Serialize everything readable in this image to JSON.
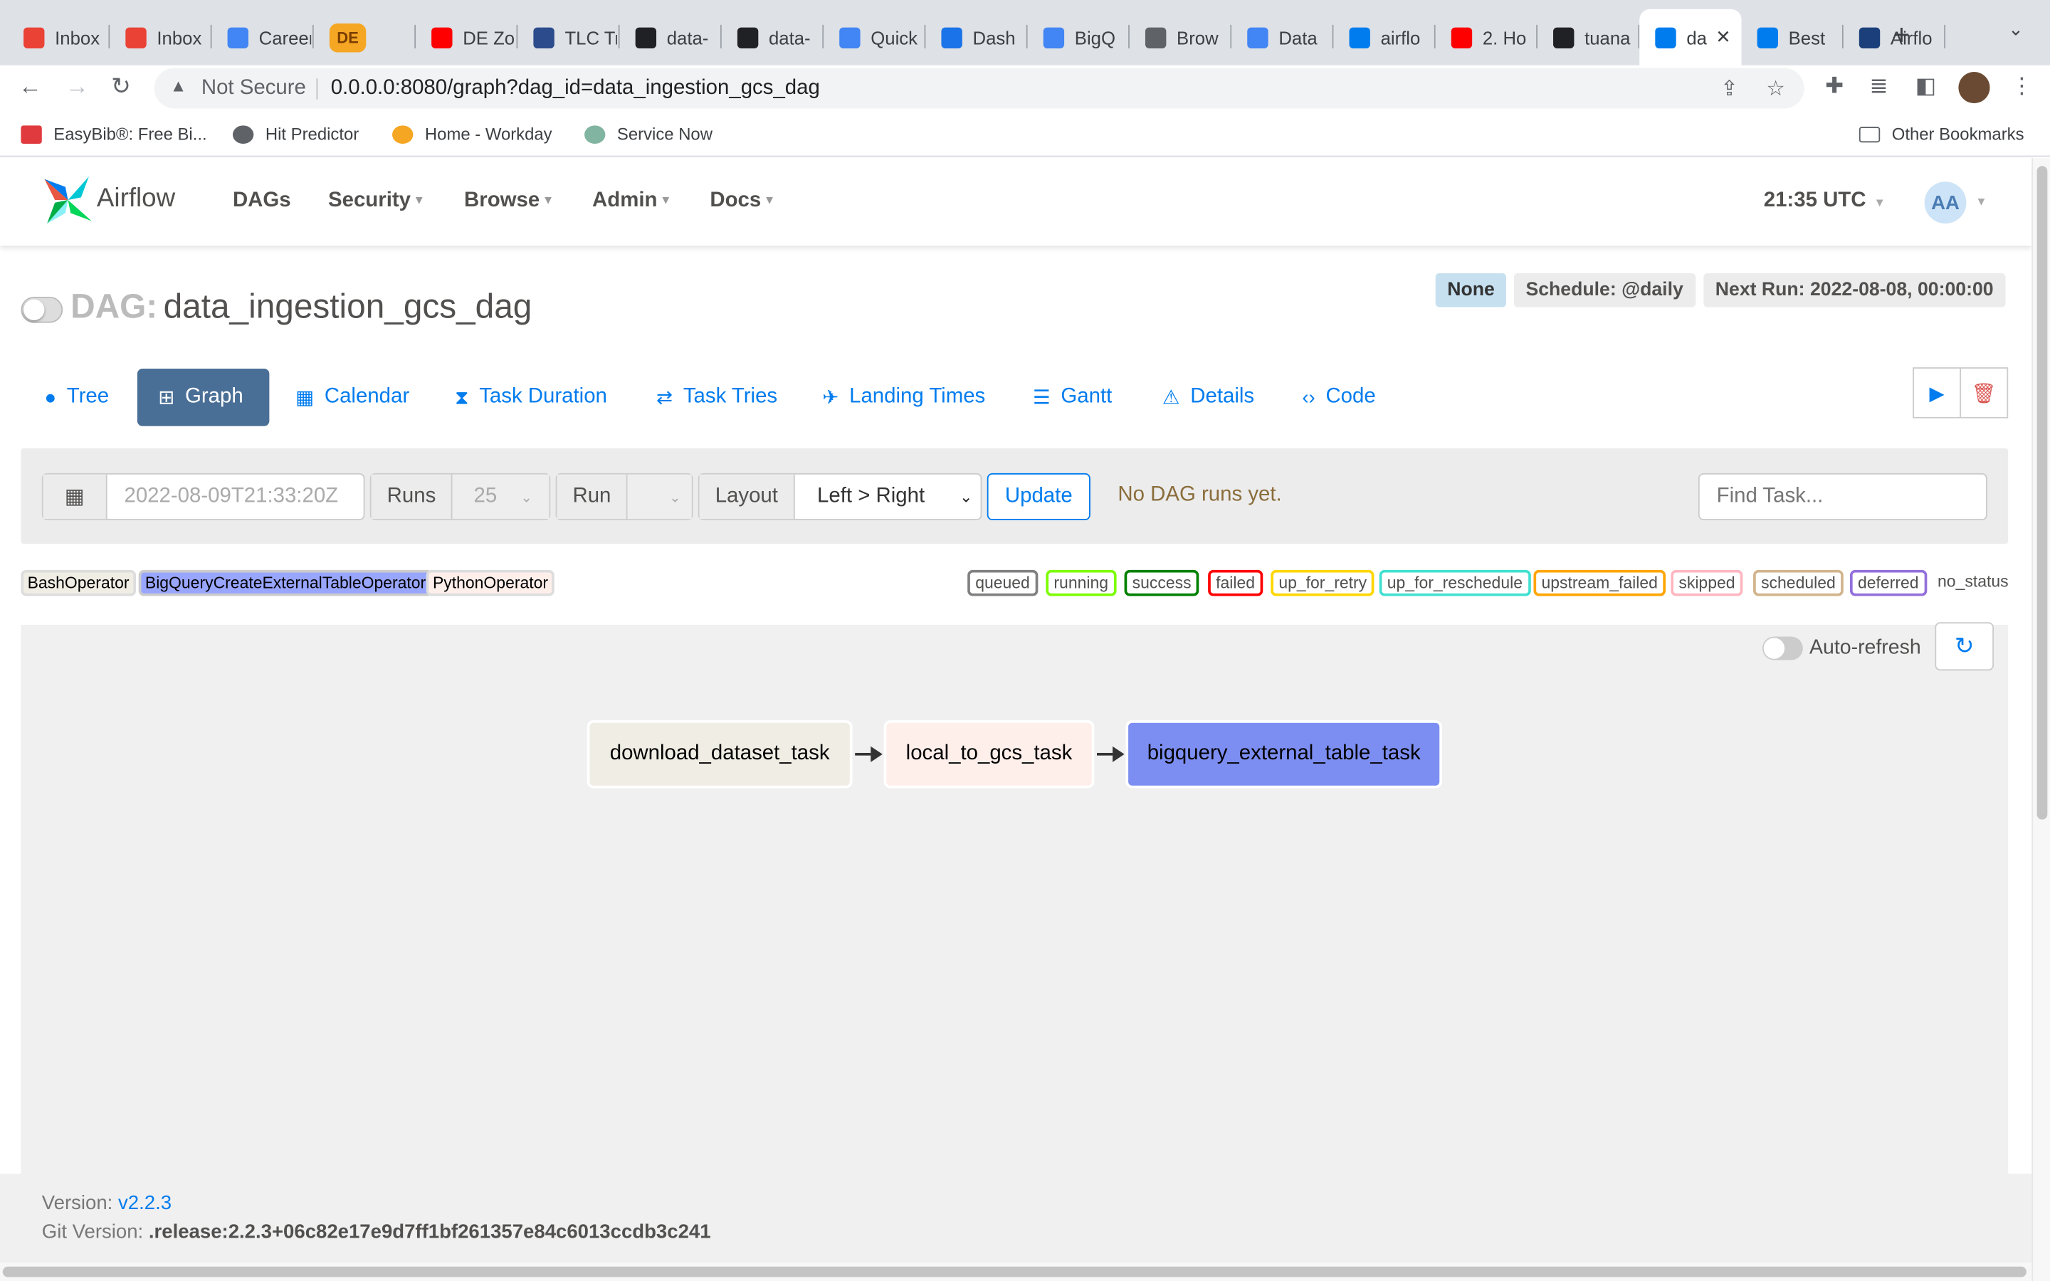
{
  "browser": {
    "tabs": [
      {
        "title": "Inbox",
        "icon": "gmail-icon",
        "color": "#ea4335"
      },
      {
        "title": "Inbox",
        "icon": "gmail-icon",
        "color": "#ea4335"
      },
      {
        "title": "Careers",
        "icon": "docs-icon",
        "color": "#4285f4"
      },
      {
        "title": "",
        "icon": "de-icon",
        "color": "#f5a623",
        "label": "DE"
      },
      {
        "title": "DE Zoomcamp",
        "icon": "youtube-icon",
        "color": "#ff0000"
      },
      {
        "title": "TLC Trip",
        "icon": "tlc-icon",
        "color": "#2b4b8c"
      },
      {
        "title": "data-",
        "icon": "github-icon",
        "color": "#202124"
      },
      {
        "title": "data-",
        "icon": "github-icon",
        "color": "#202124"
      },
      {
        "title": "Quick",
        "icon": "gcloud-icon",
        "color": "#4285f4"
      },
      {
        "title": "Dash",
        "icon": "dashboard-icon",
        "color": "#1a73e8"
      },
      {
        "title": "BigQ",
        "icon": "bigquery-icon",
        "color": "#4285f4"
      },
      {
        "title": "Brow",
        "icon": "browser-icon",
        "color": "#5f6368"
      },
      {
        "title": "Data",
        "icon": "docs-icon",
        "color": "#4285f4"
      },
      {
        "title": "airflo",
        "icon": "airflow-icon",
        "color": "#017cee"
      },
      {
        "title": "2. Ho",
        "icon": "youtube-icon",
        "color": "#ff0000"
      },
      {
        "title": "tuana",
        "icon": "github-icon",
        "color": "#202124"
      },
      {
        "title": "da",
        "icon": "airflow-icon",
        "color": "#017cee",
        "active": true
      },
      {
        "title": "Best",
        "icon": "airflow-icon",
        "color": "#017cee"
      },
      {
        "title": "Airflo",
        "icon": "medium-icon",
        "color": "#1a3f7a"
      }
    ],
    "address": {
      "security": "Not Secure",
      "url": "0.0.0.0:8080/graph?dag_id=data_ingestion_gcs_dag"
    },
    "bookmarks": [
      {
        "label": "EasyBib®: Free Bi...",
        "color": "#e03a3e"
      },
      {
        "label": "Hit Predictor",
        "color": "#5f6368"
      },
      {
        "label": "Home - Workday",
        "color": "#f5a623"
      },
      {
        "label": "Service Now",
        "color": "#81b5a1"
      }
    ],
    "other_bookmarks": "Other Bookmarks"
  },
  "airflow": {
    "brand": "Airflow",
    "menu": {
      "dags": "DAGs",
      "security": "Security",
      "browse": "Browse",
      "admin": "Admin",
      "docs": "Docs"
    },
    "clock": "21:35 UTC",
    "user_initials": "AA",
    "dag": {
      "prefix": "DAG:",
      "name": "data_ingestion_gcs_dag",
      "state_badge": "None",
      "schedule": "Schedule: @daily",
      "next_run": "Next Run: 2022-08-08, 00:00:00"
    },
    "views": {
      "tree": "Tree",
      "graph": "Graph",
      "calendar": "Calendar",
      "task_duration": "Task Duration",
      "task_tries": "Task Tries",
      "landing_times": "Landing Times",
      "gantt": "Gantt",
      "details": "Details",
      "code": "Code"
    },
    "controls": {
      "base_date": "2022-08-09T21:33:20Z",
      "runs_label": "Runs",
      "runs_value": "25",
      "run_label": "Run",
      "run_value": "",
      "layout_label": "Layout",
      "layout_value": "Left > Right",
      "update": "Update",
      "message": "No DAG runs yet.",
      "find_placeholder": "Find Task..."
    },
    "operators": [
      {
        "label": "BashOperator",
        "bg": "#f0ede4",
        "border": "#ddd"
      },
      {
        "label": "BigQueryCreateExternalTableOperator",
        "bg": "#99a6ff",
        "border": "#ccc"
      },
      {
        "label": "PythonOperator",
        "bg": "#ffefeb",
        "border": "#ddd"
      }
    ],
    "states": [
      {
        "label": "queued",
        "color": "#808080"
      },
      {
        "label": "running",
        "color": "#7cfc00"
      },
      {
        "label": "success",
        "color": "#008000"
      },
      {
        "label": "failed",
        "color": "#ff0000"
      },
      {
        "label": "up_for_retry",
        "color": "#ffd700"
      },
      {
        "label": "up_for_reschedule",
        "color": "#40e0d0"
      },
      {
        "label": "upstream_failed",
        "color": "#ffa500"
      },
      {
        "label": "skipped",
        "color": "#ffb6c1"
      },
      {
        "label": "scheduled",
        "color": "#d2b48c"
      },
      {
        "label": "deferred",
        "color": "#9370db"
      }
    ],
    "no_status": "no_status",
    "auto_refresh": "Auto-refresh",
    "graph": {
      "nodes": [
        {
          "label": "download_dataset_task",
          "bg": "#f0ede4"
        },
        {
          "label": "local_to_gcs_task",
          "bg": "#ffefeb"
        },
        {
          "label": "bigquery_external_table_task",
          "bg": "#7d8ef2"
        }
      ]
    },
    "footer": {
      "version_label": "Version:",
      "version": "v2.2.3",
      "git_label": "Git Version:",
      "git": ".release:2.2.3+06c82e17e9d7ff1bf261357e84c6013ccdb3c241"
    }
  }
}
